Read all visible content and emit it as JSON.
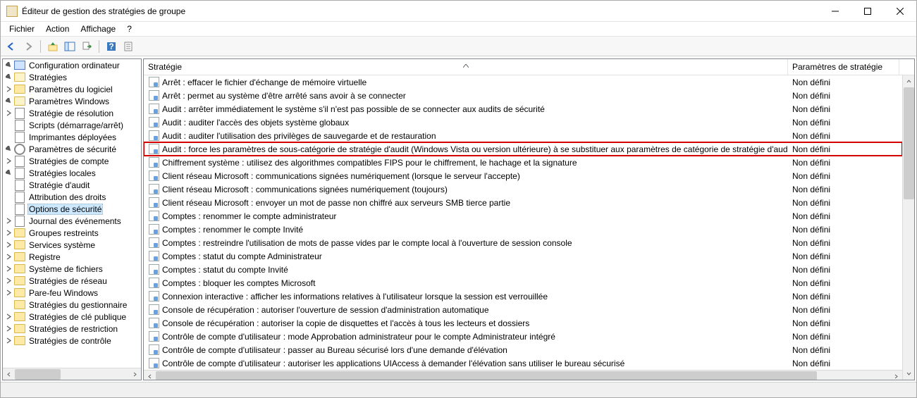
{
  "window": {
    "title": "Éditeur de gestion des stratégies de groupe"
  },
  "menu": {
    "file": "Fichier",
    "action": "Action",
    "view": "Affichage",
    "help": "?"
  },
  "columns": {
    "strategy": "Stratégie",
    "param": "Paramètres de stratégie"
  },
  "tree": {
    "root": "Configuration ordinateur",
    "strategies": "Stratégies",
    "param_log": "Paramètres du logiciel",
    "param_win": "Paramètres Windows",
    "strat_res": "Stratégie de résolution",
    "scripts": "Scripts (démarrage/arrêt)",
    "printers": "Imprimantes déployées",
    "param_sec": "Paramètres de sécurité",
    "strat_cmp": "Stratégies de compte",
    "strat_loc": "Stratégies locales",
    "strat_aud": "Stratégie d'audit",
    "attrib": "Attribution des droits",
    "options": "Options de sécurité",
    "journal": "Journal des événements",
    "groups": "Groupes restreints",
    "services": "Services système",
    "registry": "Registre",
    "filesys": "Système de fichiers",
    "strat_net": "Stratégies de réseau",
    "firewall": "Pare-feu Windows",
    "strat_nlm": "Stratégies du gestionnaire",
    "strat_pk": "Stratégies de clé publique",
    "strat_sw": "Stratégies de restriction",
    "strat_app": "Stratégies de contrôle"
  },
  "rows": [
    {
      "name": "Arrêt : effacer le fichier d'échange de mémoire virtuelle",
      "value": "Non défini",
      "hl": false
    },
    {
      "name": "Arrêt : permet au système d'être arrêté sans avoir à se connecter",
      "value": "Non défini",
      "hl": false
    },
    {
      "name": "Audit : arrêter immédiatement le système s'il n'est pas possible de se connecter aux audits de sécurité",
      "value": "Non défini",
      "hl": false
    },
    {
      "name": "Audit : auditer l'accès des objets système globaux",
      "value": "Non défini",
      "hl": false
    },
    {
      "name": "Audit : auditer l'utilisation des privilèges de sauvegarde et de restauration",
      "value": "Non défini",
      "hl": false
    },
    {
      "name": "Audit : force les paramètres de sous-catégorie de stratégie d'audit (Windows Vista ou version ultérieure) à se substituer aux paramètres de catégorie de stratégie d'audit",
      "value": "Non défini",
      "hl": true
    },
    {
      "name": "Chiffrement système : utilisez des algorithmes compatibles FIPS pour le chiffrement, le hachage et la signature",
      "value": "Non défini",
      "hl": false
    },
    {
      "name": "Client réseau Microsoft : communications signées numériquement (lorsque le serveur l'accepte)",
      "value": "Non défini",
      "hl": false
    },
    {
      "name": "Client réseau Microsoft : communications signées numériquement (toujours)",
      "value": "Non défini",
      "hl": false
    },
    {
      "name": "Client réseau Microsoft : envoyer un mot de passe non chiffré aux serveurs SMB tierce partie",
      "value": "Non défini",
      "hl": false
    },
    {
      "name": "Comptes : renommer le compte administrateur",
      "value": "Non défini",
      "hl": false
    },
    {
      "name": "Comptes : renommer le compte Invité",
      "value": "Non défini",
      "hl": false
    },
    {
      "name": "Comptes : restreindre l'utilisation de mots de passe vides par le compte local à l'ouverture de session console",
      "value": "Non défini",
      "hl": false
    },
    {
      "name": "Comptes : statut du compte Administrateur",
      "value": "Non défini",
      "hl": false
    },
    {
      "name": "Comptes : statut du compte Invité",
      "value": "Non défini",
      "hl": false
    },
    {
      "name": "Comptes : bloquer les comptes Microsoft",
      "value": "Non défini",
      "hl": false
    },
    {
      "name": "Connexion interactive : afficher les informations relatives à l'utilisateur lorsque la session est verrouillée",
      "value": "Non défini",
      "hl": false
    },
    {
      "name": "Console de récupération : autoriser l'ouverture de session d'administration automatique",
      "value": "Non défini",
      "hl": false
    },
    {
      "name": "Console de récupération : autoriser la copie de disquettes et l'accès à tous les lecteurs et dossiers",
      "value": "Non défini",
      "hl": false
    },
    {
      "name": "Contrôle de compte d'utilisateur : mode Approbation administrateur pour le compte Administrateur intégré",
      "value": "Non défini",
      "hl": false
    },
    {
      "name": "Contrôle de compte d'utilisateur : passer au Bureau sécurisé lors d'une demande d'élévation",
      "value": "Non défini",
      "hl": false
    },
    {
      "name": "Contrôle de compte d'utilisateur : autoriser les applications UIAccess à demander l'élévation sans utiliser le bureau sécurisé",
      "value": "Non défini",
      "hl": false
    }
  ]
}
